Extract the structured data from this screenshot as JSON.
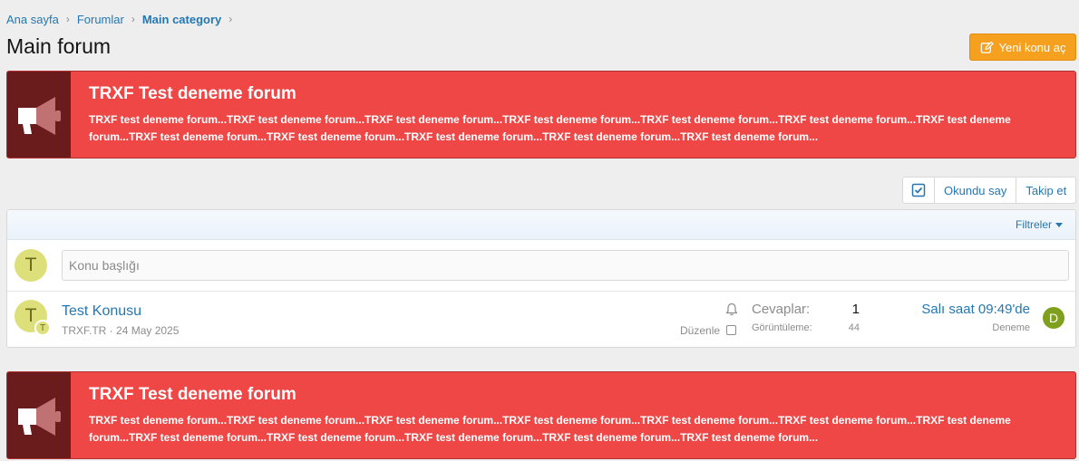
{
  "breadcrumb": {
    "items": [
      "Ana sayfa",
      "Forumlar",
      "Main category"
    ]
  },
  "page": {
    "title": "Main forum"
  },
  "actions": {
    "new_topic_label": "Yeni konu aç",
    "mark_read_label": "Okundu say",
    "follow_label": "Takip et",
    "filters_label": "Filtreler"
  },
  "notices": [
    {
      "title": "TRXF Test deneme forum",
      "text": "TRXF test deneme forum...TRXF test deneme forum...TRXF test deneme forum...TRXF test deneme forum...TRXF test deneme forum...TRXF test deneme forum...TRXF test deneme forum...TRXF test deneme forum...TRXF test deneme forum...TRXF test deneme forum...TRXF test deneme forum...TRXF test deneme forum..."
    },
    {
      "title": "TRXF Test deneme forum",
      "text": "TRXF test deneme forum...TRXF test deneme forum...TRXF test deneme forum...TRXF test deneme forum...TRXF test deneme forum...TRXF test deneme forum...TRXF test deneme forum...TRXF test deneme forum...TRXF test deneme forum...TRXF test deneme forum...TRXF test deneme forum...TRXF test deneme forum..."
    }
  ],
  "quick_thread": {
    "avatar_letter": "T",
    "placeholder": "Konu başlığı"
  },
  "thread": {
    "avatar_letter": "T",
    "avatar_small_letter": "T",
    "title": "Test Konusu",
    "author": "TRXF.TR",
    "separator": " · ",
    "date": "24 May 2025",
    "edit_label": "Düzenle",
    "replies_label": "Cevaplar:",
    "replies": "1",
    "views_label": "Görüntüleme:",
    "views": "44",
    "last_post_date": "Salı saat 09:49'de",
    "last_post_user": "Deneme",
    "last_post_avatar_letter": "D"
  },
  "icons": {
    "breadcrumb_separator": "chevron-right-icon",
    "new_topic": "edit-icon",
    "mark_read": "checkbox-icon",
    "notice": "megaphone-icon",
    "watch": "bell-icon"
  },
  "colors": {
    "accent": "#2577b1",
    "notice_bg": "#ef4646",
    "notice_icon_bg": "#6a1b1b",
    "button_orange": "#f5a01e",
    "avatar_yellow": "#dde07a",
    "avatar_green": "#7ea01c"
  }
}
